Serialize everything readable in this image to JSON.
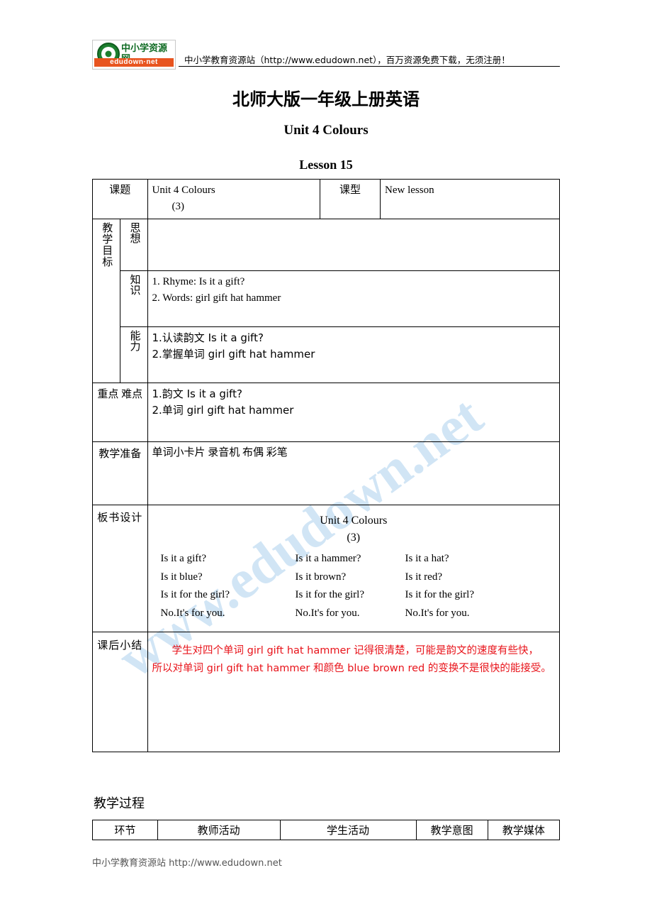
{
  "header": {
    "logo_cn": "中小学资源网",
    "logo_en": "edudown·net",
    "site_line": "中小学教育资源站（http://www.edudown.net），百万资源免费下载，无须注册！"
  },
  "titles": {
    "doc_title": "北师大版一年级上册英语",
    "unit_title": "Unit 4 Colours",
    "lesson_title": "Lesson 15"
  },
  "watermark": {
    "line1": "www.edudown.net"
  },
  "table": {
    "topic_label": "课题",
    "topic_value_line1": "Unit 4 Colours",
    "topic_value_line2": "(3)",
    "type_label": "课型",
    "type_value": "New lesson",
    "goals_label": "教学目标",
    "goal_think_label": "思想",
    "goal_think_value": "",
    "goal_knowledge_label": "知识",
    "goal_knowledge_line1": "1. Rhyme: Is it a gift?",
    "goal_knowledge_line2": "2. Words: girl   gift   hat   hammer",
    "goal_ability_label": "能力",
    "goal_ability_line1": "1.认读韵文 Is it a gift?",
    "goal_ability_line2": "2.掌握单词 girl   gift   hat   hammer",
    "key_label": "重点 难点",
    "key_line1": "1.韵文 Is it a gift?",
    "key_line2": "2.单词 girl   gift   hat   hammer",
    "prep_label": "教学准备",
    "prep_value": "单词小卡片 录音机 布偶 彩笔",
    "board_label": "板书设计",
    "board_title": "Unit 4 Colours",
    "board_subtitle": "(3)",
    "board_rows": [
      [
        "Is it a gift?",
        "Is it a hammer?",
        "Is it a hat?"
      ],
      [
        "Is it blue?",
        "Is it brown?",
        "Is it red?"
      ],
      [
        "Is it for the girl?",
        "Is it for the girl?",
        "Is it for the girl?"
      ],
      [
        "No.It's for you.",
        "No.It's for you.",
        "No.It's for you."
      ]
    ],
    "summary_label": "课后小结",
    "summary_line1": "学生对四个单词 girl   gift   hat   hammer  记得很清楚，可能是韵文的速度有些快，",
    "summary_line2": "所以对单词 girl   gift   hat   hammer 和颜色 blue   brown   red 的变换不是很快的能接受。"
  },
  "process": {
    "title": "教学过程",
    "headers": [
      "环节",
      "教师活动",
      "学生活动",
      "教学意图",
      "教学媒体"
    ]
  },
  "footer": {
    "text": "中小学教育资源站 http://www.edudown.net"
  },
  "colors": {
    "note_red": "#e8131a",
    "watermark_blue": "#cfe4f5",
    "logo_green": "#1d7f2f",
    "logo_orange": "#e8541f"
  }
}
